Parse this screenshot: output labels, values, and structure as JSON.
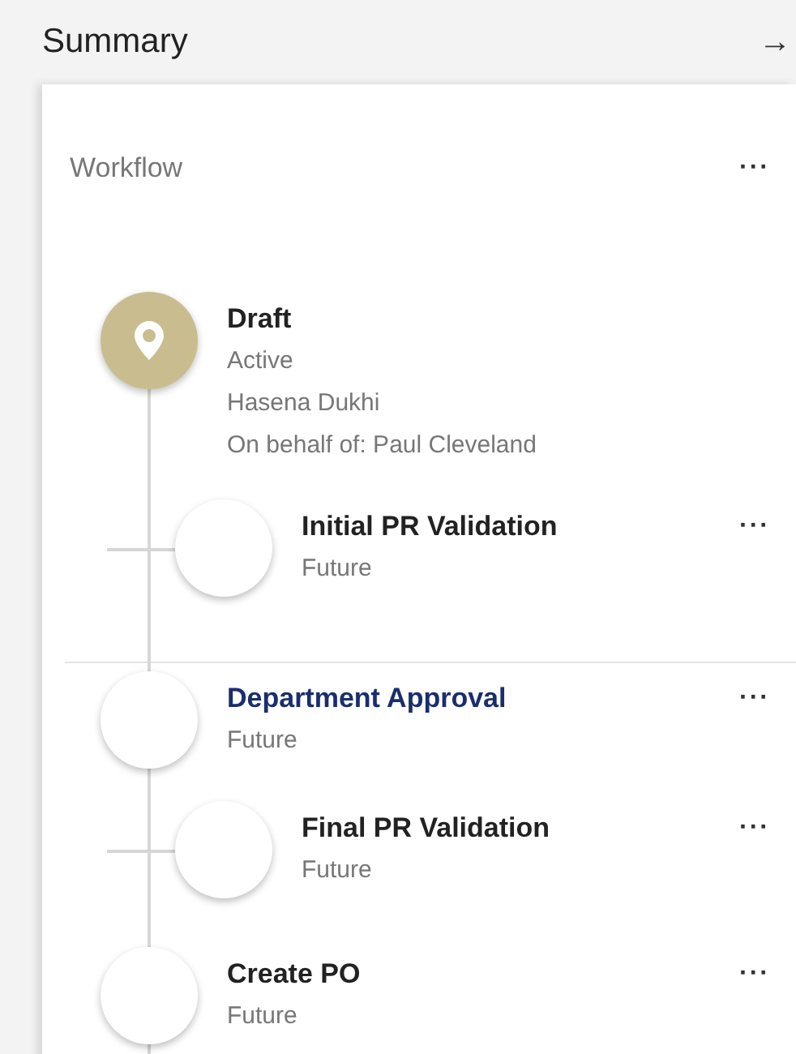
{
  "header": {
    "title": "Summary",
    "action": "→"
  },
  "workflow": {
    "title": "Workflow",
    "menu": "···",
    "sections": [
      {
        "steps": [
          {
            "title": "Draft",
            "active": true,
            "selected": false,
            "lines": [
              "Active",
              "Hasena Dukhi",
              "On behalf of: Paul Cleveland"
            ],
            "children": [
              {
                "title": "Initial PR Validation",
                "active": false,
                "selected": false,
                "lines": [
                  "Future"
                ],
                "menu": "···"
              }
            ]
          }
        ]
      },
      {
        "steps": [
          {
            "title": "Department Approval",
            "active": false,
            "selected": true,
            "lines": [
              "Future"
            ],
            "menu": "···",
            "children": [
              {
                "title": "Final PR Validation",
                "active": false,
                "selected": false,
                "lines": [
                  "Future"
                ],
                "menu": "···"
              }
            ]
          },
          {
            "title": "Create PO",
            "active": false,
            "selected": false,
            "lines": [
              "Future"
            ],
            "menu": "···"
          }
        ]
      }
    ]
  }
}
